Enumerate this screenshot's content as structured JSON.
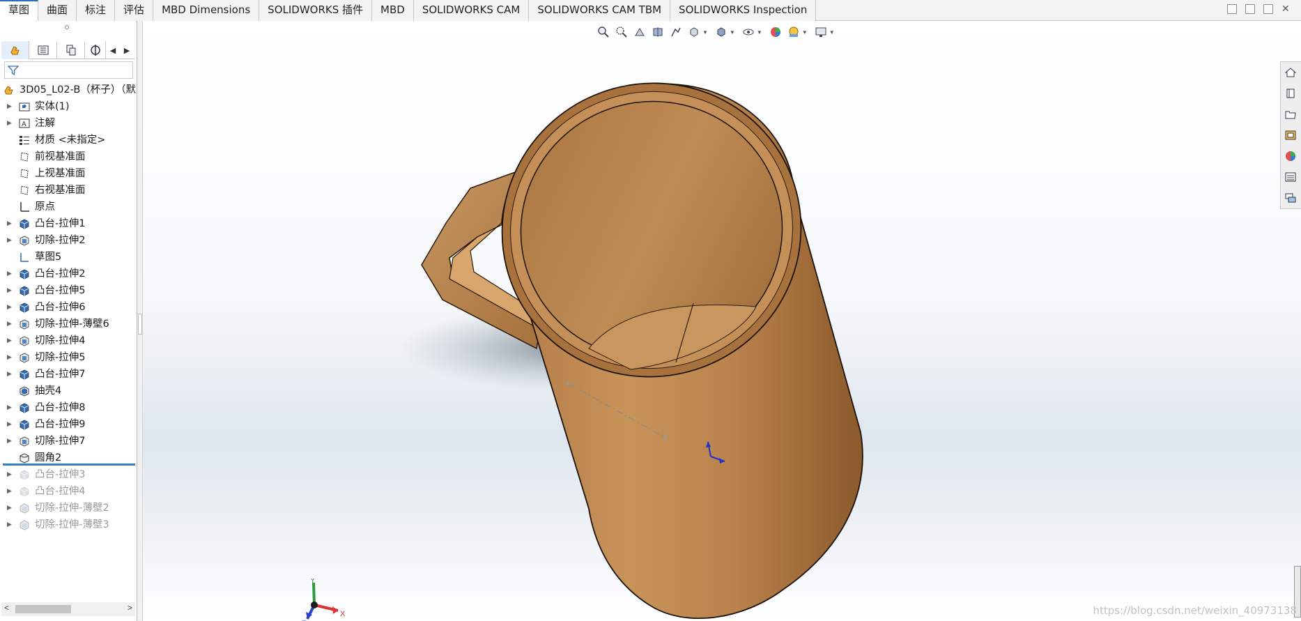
{
  "command_tabs": [
    {
      "label": "草图",
      "active": true
    },
    {
      "label": "曲面",
      "active": false
    },
    {
      "label": "标注",
      "active": false
    },
    {
      "label": "评估",
      "active": false
    },
    {
      "label": "MBD Dimensions",
      "active": false
    },
    {
      "label": "SOLIDWORKS 插件",
      "active": false
    },
    {
      "label": "MBD",
      "active": false
    },
    {
      "label": "SOLIDWORKS CAM",
      "active": false
    },
    {
      "label": "SOLIDWORKS CAM TBM",
      "active": false
    },
    {
      "label": "SOLIDWORKS Inspection",
      "active": false
    }
  ],
  "feature_tree": {
    "root": "3D05_L02-B（杯子）（默",
    "items": [
      {
        "label": "实体(1)",
        "icon": "solid-bodies-folder-icon",
        "expandable": true,
        "suppressed": false
      },
      {
        "label": "注解",
        "icon": "annotations-icon",
        "expandable": true,
        "suppressed": false
      },
      {
        "label": "材质 <未指定>",
        "icon": "material-icon",
        "expandable": false,
        "suppressed": false
      },
      {
        "label": "前视基准面",
        "icon": "plane-icon",
        "expandable": false,
        "suppressed": false
      },
      {
        "label": "上视基准面",
        "icon": "plane-icon",
        "expandable": false,
        "suppressed": false
      },
      {
        "label": "右视基准面",
        "icon": "plane-icon",
        "expandable": false,
        "suppressed": false
      },
      {
        "label": "原点",
        "icon": "origin-icon",
        "expandable": false,
        "suppressed": false
      },
      {
        "label": "凸台-拉伸1",
        "icon": "boss-extrude-icon",
        "expandable": true,
        "suppressed": false
      },
      {
        "label": "切除-拉伸2",
        "icon": "cut-extrude-icon",
        "expandable": true,
        "suppressed": false
      },
      {
        "label": "草图5",
        "icon": "sketch-icon",
        "expandable": false,
        "suppressed": false
      },
      {
        "label": "凸台-拉伸2",
        "icon": "boss-extrude-icon",
        "expandable": true,
        "suppressed": false
      },
      {
        "label": "凸台-拉伸5",
        "icon": "boss-extrude-icon",
        "expandable": true,
        "suppressed": false
      },
      {
        "label": "凸台-拉伸6",
        "icon": "boss-extrude-icon",
        "expandable": true,
        "suppressed": false
      },
      {
        "label": "切除-拉伸-薄壁6",
        "icon": "cut-extrude-icon",
        "expandable": true,
        "suppressed": false
      },
      {
        "label": "切除-拉伸4",
        "icon": "cut-extrude-icon",
        "expandable": true,
        "suppressed": false
      },
      {
        "label": "切除-拉伸5",
        "icon": "cut-extrude-icon",
        "expandable": true,
        "suppressed": false
      },
      {
        "label": "凸台-拉伸7",
        "icon": "boss-extrude-icon",
        "expandable": true,
        "suppressed": false
      },
      {
        "label": "抽壳4",
        "icon": "shell-icon",
        "expandable": false,
        "suppressed": false
      },
      {
        "label": "凸台-拉伸8",
        "icon": "boss-extrude-icon",
        "expandable": true,
        "suppressed": false
      },
      {
        "label": "凸台-拉伸9",
        "icon": "boss-extrude-icon",
        "expandable": true,
        "suppressed": false
      },
      {
        "label": "切除-拉伸7",
        "icon": "cut-extrude-icon",
        "expandable": true,
        "suppressed": false
      },
      {
        "label": "圆角2",
        "icon": "fillet-icon",
        "expandable": false,
        "suppressed": false
      },
      {
        "label": "凸台-拉伸3",
        "icon": "boss-extrude-icon",
        "expandable": true,
        "suppressed": true
      },
      {
        "label": "凸台-拉伸4",
        "icon": "boss-extrude-icon",
        "expandable": true,
        "suppressed": true
      },
      {
        "label": "切除-拉伸-薄壁2",
        "icon": "cut-extrude-icon",
        "expandable": true,
        "suppressed": true
      },
      {
        "label": "切除-拉伸-薄壁3",
        "icon": "cut-extrude-icon",
        "expandable": true,
        "suppressed": true
      }
    ]
  },
  "triad": {
    "x": "X",
    "y": "Y",
    "z": "Z"
  },
  "watermark": "https://blog.csdn.net/weixin_40973138",
  "colors": {
    "accent": "#2f7fc1",
    "wood_light": "#c8945a",
    "wood_dark": "#8a5a2b",
    "suppressed_text": "#9a9a9a"
  }
}
